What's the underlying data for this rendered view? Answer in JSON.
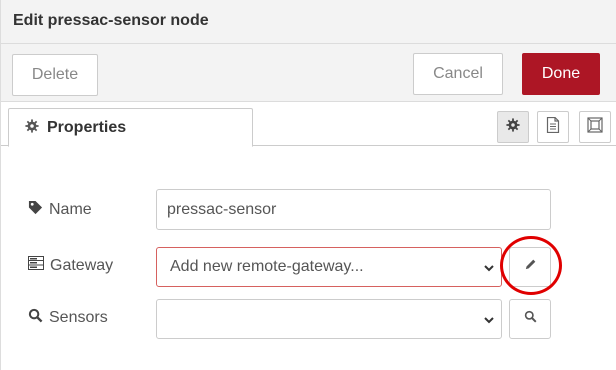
{
  "header": {
    "title": "Edit pressac-sensor node"
  },
  "toolbar": {
    "delete_label": "Delete",
    "cancel_label": "Cancel",
    "done_label": "Done"
  },
  "tabs": [
    {
      "label": "Properties",
      "icon": "gear-icon"
    }
  ],
  "tab_icons": [
    "gear-icon",
    "document-icon",
    "layout-icon"
  ],
  "form": {
    "name": {
      "label": "Name",
      "icon": "tag-icon",
      "value": "pressac-sensor"
    },
    "gateway": {
      "label": "Gateway",
      "icon": "server-icon",
      "selected": "Add new remote-gateway...",
      "action_icon": "pencil-icon"
    },
    "sensors": {
      "label": "Sensors",
      "icon": "search-icon",
      "selected": "",
      "action_icon": "search-icon"
    }
  },
  "colors": {
    "accent": "#ad1625",
    "highlight": "#e00000",
    "error_border": "#d6615f"
  }
}
